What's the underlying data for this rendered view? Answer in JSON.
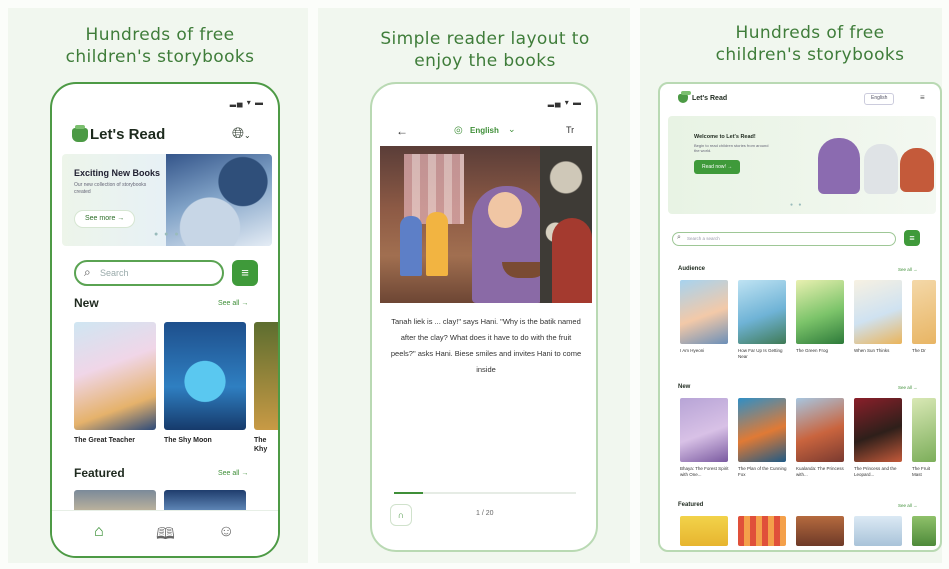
{
  "captions": {
    "left": "Hundreds of free children's storybooks",
    "middle": "Simple reader layout to enjoy the books",
    "right": "Hundreds of free children's storybooks"
  },
  "phone_home": {
    "status": "▂▄ ▾ ▬",
    "app_title": "Let's Read",
    "banner": {
      "title": "Exciting New Books",
      "subtitle": "Our new collection of storybooks created",
      "button": "See more →"
    },
    "search_placeholder": "Search",
    "sections": {
      "new": {
        "title": "New",
        "see_all": "See all →"
      },
      "featured": {
        "title": "Featured",
        "see_all": "See all →"
      }
    },
    "books": [
      {
        "label": "The Great Teacher"
      },
      {
        "label": "The Shy Moon"
      },
      {
        "label": "The Khy"
      }
    ]
  },
  "phone_reader": {
    "status": "▂▄ ▾ ▬",
    "language": "English",
    "text_size_icon": "Tr",
    "story_text": "Tanah liek is ... clay!\" says Hani. \"Why is the batik named after the clay? What does it have to do with the fruit peels?\" asks Hani. Biese smiles and invites Hani to come inside",
    "page_indicator": "1 / 20",
    "progress_fraction": 0.16
  },
  "tablet": {
    "app_title": "Let's Read",
    "language_button": "English",
    "banner": {
      "title": "Welcome to Let's Read!",
      "subtitle": "Begin to read children stories from around the world.",
      "button": "Read now! →"
    },
    "search_placeholder": "Search a search",
    "sections": [
      {
        "title": "Audience",
        "see_all": "See all →",
        "books": [
          "I Am Hyeoni",
          "How Far Up Is Getting Near",
          "The Green Frog",
          "When Sun Thinks",
          "The Dr"
        ]
      },
      {
        "title": "New",
        "see_all": "See all →",
        "books": [
          "Bhaya: The Forest Spirit with One...",
          "The Plan of the Cunning Fox",
          "Kualanda: The Princess with...",
          "The Princess and the Leopard...",
          "The Fruit Mast"
        ]
      },
      {
        "title": "Featured",
        "see_all": "See all →",
        "books": []
      }
    ]
  },
  "colors": {
    "brand_green": "#3f9a3a",
    "caption_green": "#3f7d3a",
    "panel_bg": "#f1f7ef"
  },
  "icons": {
    "logo": "lets-read-logo-icon",
    "globe": "globe-icon",
    "search": "search-icon",
    "filter": "filter-icon",
    "home": "home-icon",
    "library": "book-icon",
    "profile": "profile-icon",
    "back": "back-arrow-icon",
    "audio": "headphones-icon"
  }
}
